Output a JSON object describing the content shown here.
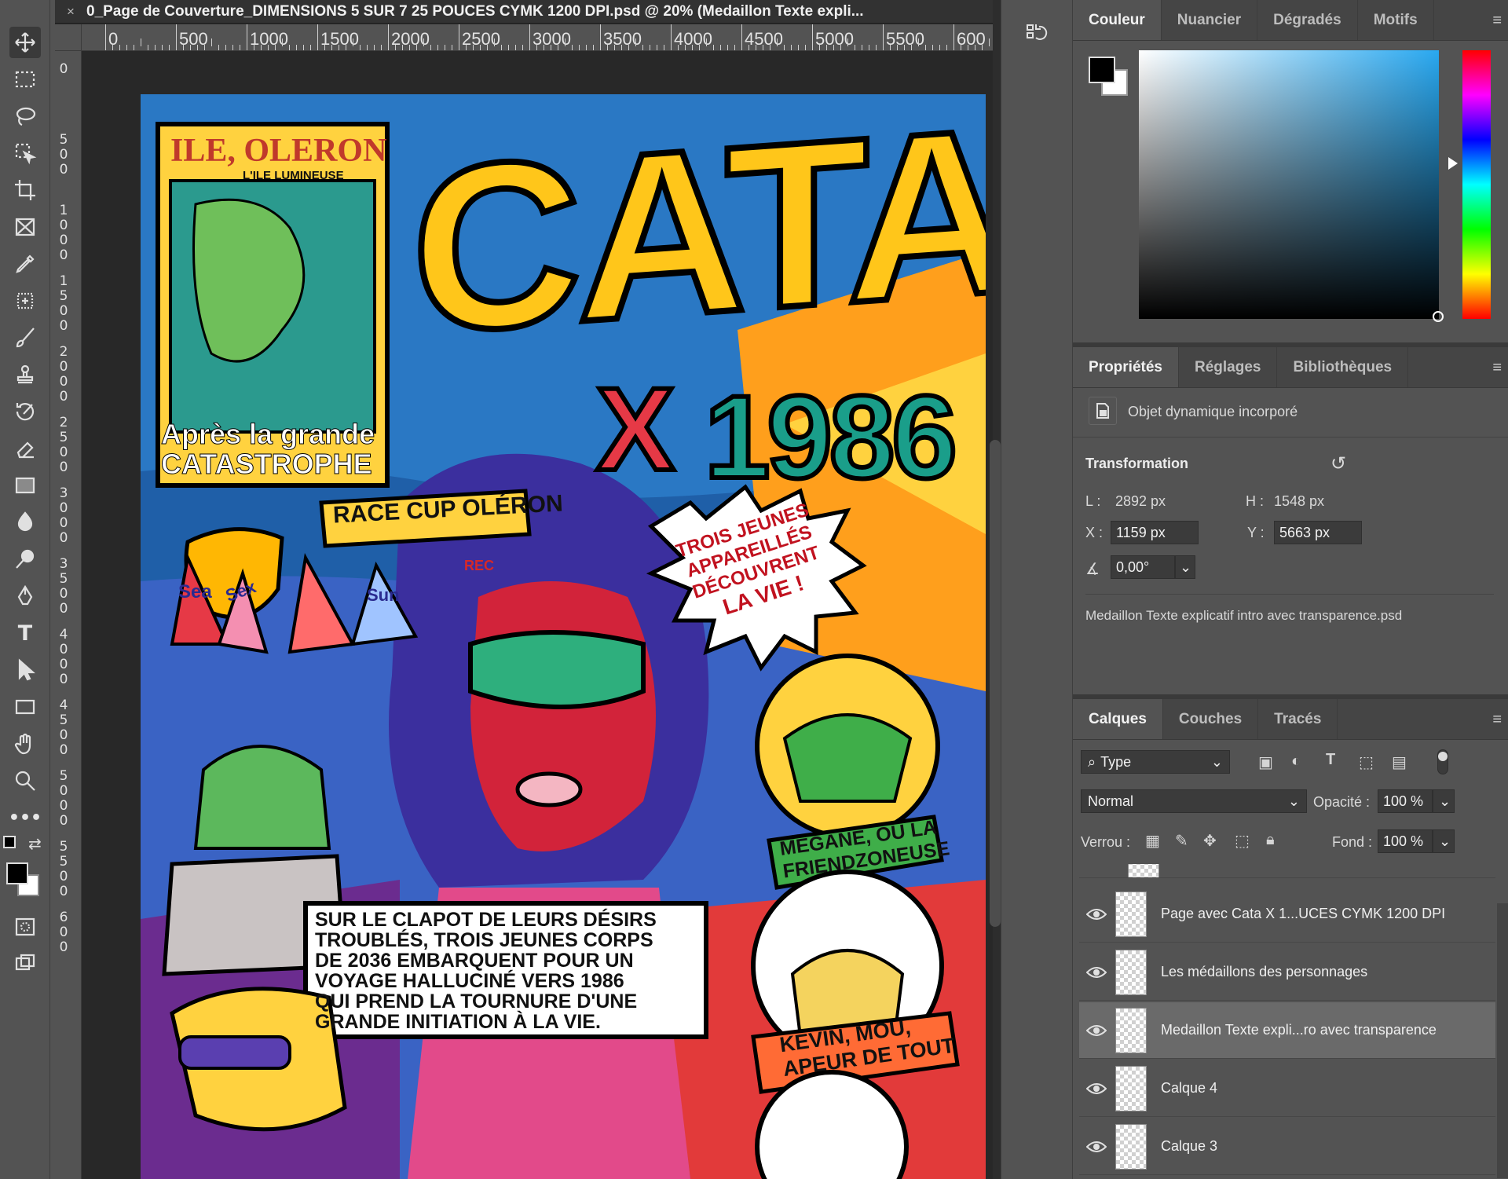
{
  "document": {
    "tab_title": "0_Page de Couverture_DIMENSIONS 5 SUR 7 25 POUCES CYMK 1200 DPI.psd @ 20% (Medaillon Texte expli...",
    "close_glyph": "×",
    "ruler_labels": [
      "0",
      "500",
      "1000",
      "1500",
      "2000",
      "2500",
      "3000",
      "3500",
      "4000",
      "4500",
      "5000",
      "5500",
      "600"
    ]
  },
  "artwork": {
    "map_title": "ILE, OLERON",
    "map_subtitle": "L'ILE LUMINEUSE",
    "map_caption_1": "Après la grande",
    "map_caption_2": "CATASTROPHE",
    "title": "CATA",
    "title_x": "X",
    "title_year": "1986",
    "race_label": "RACE CUP OLÉRON",
    "sail_1": "Sea",
    "sail_2": "Sex",
    "sail_3": "Sun",
    "rec": "REC",
    "burst_text": [
      "TROIS JEUNES",
      "APPAREILLÉS",
      "DÉCOUVRENT",
      "LA VIE !"
    ],
    "megane_label": [
      "MEGANE, OU LA",
      "FRIENDZONEUSE"
    ],
    "kevin_label": [
      "KEVIN, MOU,",
      "APEUR DE TOUT"
    ],
    "story_lines": [
      "SUR LE CLAPOT DE LEURS DÉSIRS",
      "TROUBLÉS, TROIS JEUNES CORPS",
      "DE 2036 EMBARQUENT POUR UN",
      "VOYAGE HALLUCINÉ VERS 1986",
      "QUI PREND LA TOURNURE D'UNE",
      "GRANDE INITIATION À LA VIE."
    ]
  },
  "color_panel": {
    "tabs": [
      "Couleur",
      "Nuancier",
      "Dégradés",
      "Motifs"
    ],
    "active_tab": "Couleur"
  },
  "properties_panel": {
    "tabs": [
      "Propriétés",
      "Réglages",
      "Bibliothèques"
    ],
    "object_type": "Objet dynamique incorporé",
    "section": "Transformation",
    "width_label": "L :",
    "width_value": "2892 px",
    "height_label": "H :",
    "height_value": "1548 px",
    "x_label": "X :",
    "x_value": "1159 px",
    "y_label": "Y :",
    "y_value": "5663 px",
    "angle_value": "0,00°",
    "linked_file": "Medaillon Texte explicatif intro avec transparence.psd"
  },
  "layers_panel": {
    "tabs": [
      "Calques",
      "Couches",
      "Tracés"
    ],
    "filter_type": "Type",
    "blend_mode": "Normal",
    "opacity_label": "Opacité :",
    "opacity_value": "100 %",
    "lock_label": "Verrou :",
    "fill_label": "Fond :",
    "fill_value": "100 %",
    "layers": [
      {
        "name": "Page avec Cata X 1...UCES CYMK 1200 DPI",
        "visible": true,
        "selected": false
      },
      {
        "name": "Les médaillons des personnages",
        "visible": true,
        "selected": false
      },
      {
        "name": "Medaillon Texte expli...ro avec transparence",
        "visible": true,
        "selected": true
      },
      {
        "name": "Calque 4",
        "visible": true,
        "selected": false
      },
      {
        "name": "Calque 3",
        "visible": true,
        "selected": false
      }
    ]
  },
  "colors": {
    "foreground": "#000000",
    "background": "#ffffff",
    "ui_panel": "#535353",
    "selected_layer": "#6a6a6a"
  }
}
